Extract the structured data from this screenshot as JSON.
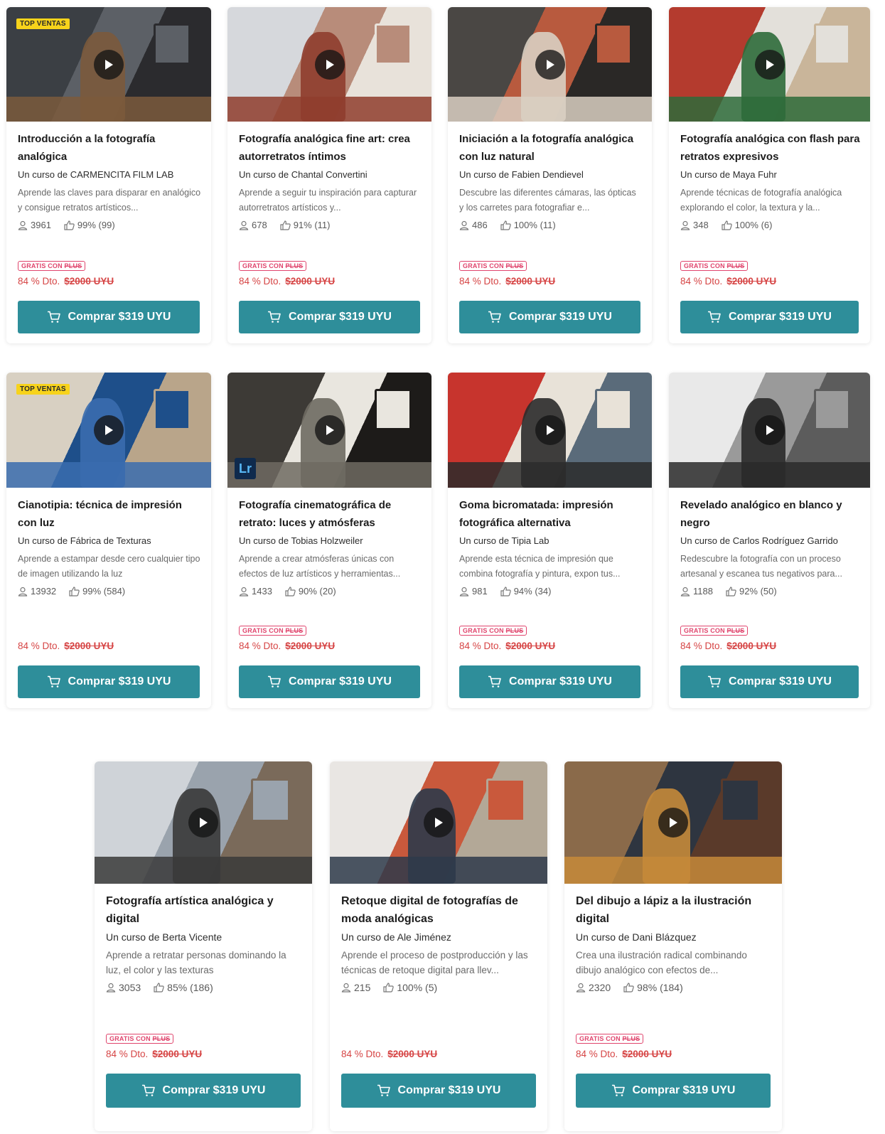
{
  "badges": {
    "top_sales": "TOP VENTAS",
    "gratis": "GRATIS CON ",
    "plus": "PLUS"
  },
  "buy_label": "Comprar  $319 UYU",
  "discount_label": "84 % Dto.",
  "old_price": "$2000 UYU",
  "lr_label": "Lr",
  "colors": {
    "teal_button": "#2e8e9a",
    "discount_red": "#d64545",
    "plus_pink": "#e0456d",
    "top_badge_yellow": "#f7d31b"
  },
  "courses": [
    {
      "title": "Introducción a la fotografía analógica",
      "author": "Un curso de CARMENCITA FILM LAB",
      "desc": "Aprende las claves para disparar en analógico y consigue retratos artísticos...",
      "students": "3961",
      "rating": "99% (99)",
      "top_sales": true,
      "plus": true
    },
    {
      "title": "Fotografía analógica fine art: crea autorretratos íntimos",
      "author": "Un curso de Chantal Convertini",
      "desc": "Aprende a seguir tu inspiración para capturar autorretratos artísticos y...",
      "students": "678",
      "rating": "91% (11)",
      "top_sales": false,
      "plus": true
    },
    {
      "title": "Iniciación a la fotografía analógica con luz natural",
      "author": "Un curso de Fabien Dendievel",
      "desc": "Descubre las diferentes cámaras, las ópticas y los carretes para fotografiar e...",
      "students": "486",
      "rating": "100% (11)",
      "top_sales": false,
      "plus": true
    },
    {
      "title": "Fotografía analógica con flash para retratos expresivos",
      "author": "Un curso de Maya Fuhr",
      "desc": "Aprende técnicas de fotografía analógica explorando el color, la textura y la...",
      "students": "348",
      "rating": "100% (6)",
      "top_sales": false,
      "plus": true
    },
    {
      "title": "Cianotipia: técnica de impresión con luz",
      "author": "Un curso de Fábrica de Texturas",
      "desc": "Aprende a estampar desde cero cualquier tipo de imagen utilizando la luz",
      "students": "13932",
      "rating": "99% (584)",
      "top_sales": true,
      "plus": false
    },
    {
      "title": "Fotografía cinematográfica de retrato: luces y atmósferas",
      "author": "Un curso de Tobias Holzweiler",
      "desc": "Aprende a crear atmósferas únicas con efectos de luz artísticos y herramientas...",
      "students": "1433",
      "rating": "90% (20)",
      "top_sales": false,
      "plus": true
    },
    {
      "title": "Goma bicromatada: impresión fotográfica alternativa",
      "author": "Un curso de Tipia Lab",
      "desc": "Aprende esta técnica de impresión que combina fotografía y pintura, expon tus...",
      "students": "981",
      "rating": "94% (34)",
      "top_sales": false,
      "plus": true
    },
    {
      "title": "Revelado analógico en blanco y negro",
      "author": "Un curso de Carlos Rodríguez Garrido",
      "desc": "Redescubre la fotografía con un proceso artesanal y escanea tus negativos para...",
      "students": "1188",
      "rating": "92% (50)",
      "top_sales": false,
      "plus": true
    },
    {
      "title": "Fotografía artística analógica y digital",
      "author": "Un curso de Berta Vicente",
      "desc": "Aprende a retratar personas dominando la luz, el color y las texturas",
      "students": "3053",
      "rating": "85% (186)",
      "top_sales": false,
      "plus": true
    },
    {
      "title": "Retoque digital de fotografías de moda analógicas",
      "author": "Un curso de Ale Jiménez",
      "desc": "Aprende el proceso de postproducción y las técnicas de retoque digital para llev...",
      "students": "215",
      "rating": "100% (5)",
      "top_sales": false,
      "plus": false
    },
    {
      "title": "Del dibujo a lápiz a la ilustración digital",
      "author": "Un curso de Dani Blázquez",
      "desc": "Crea una ilustración radical combinando dibujo analógico con efectos de...",
      "students": "2320",
      "rating": "98% (184)",
      "top_sales": false,
      "plus": true
    }
  ]
}
